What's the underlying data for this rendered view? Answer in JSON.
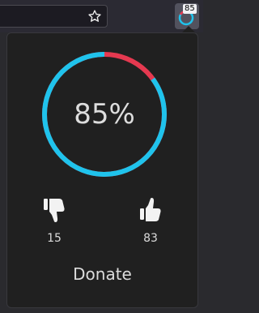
{
  "toolbar": {
    "extension_badge": "85"
  },
  "popup": {
    "score_label": "85%",
    "score_fraction": 0.85,
    "dislikes": "15",
    "likes": "83",
    "donate_label": "Donate"
  },
  "colors": {
    "positive": "#1fc3ec",
    "negative": "#e53950",
    "text": "#dcdcdc",
    "popup_bg": "#202020"
  },
  "icons": {
    "bookmark": "star-icon",
    "dislike": "thumbs-down-icon",
    "like": "thumbs-up-icon",
    "extension": "ring-icon"
  }
}
